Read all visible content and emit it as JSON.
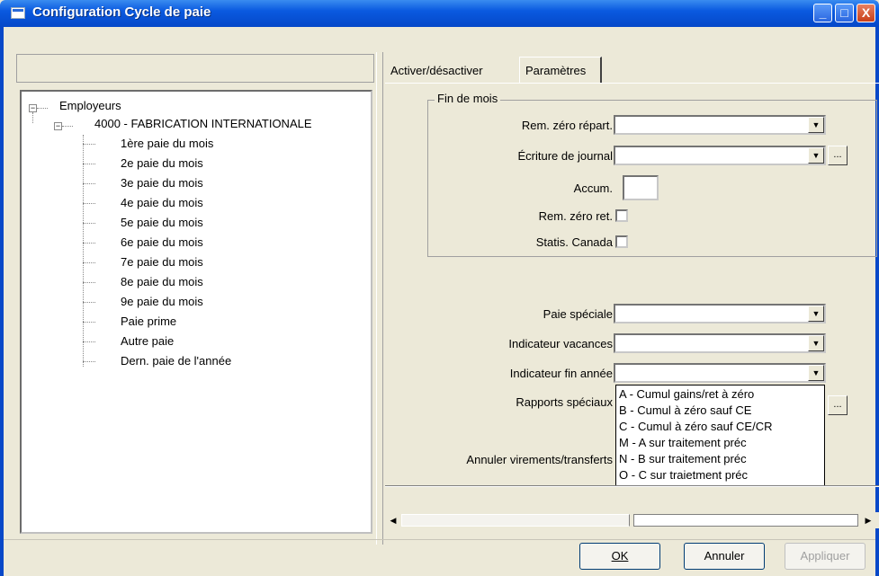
{
  "window": {
    "title": "Configuration Cycle de paie",
    "buttons": {
      "minimize": "_",
      "maximize": "□",
      "close": "X"
    }
  },
  "tree": {
    "root": "Employeurs",
    "company": "4000 - FABRICATION INTERNATIONALE",
    "items": [
      "1ère paie du mois",
      "2e paie du mois",
      "3e paie du mois",
      "4e paie du mois",
      "5e paie du mois",
      "6e paie du mois",
      "7e paie du mois",
      "8e paie du mois",
      "9e paie du mois",
      "Paie prime",
      "Autre paie",
      "Dern. paie de l'année"
    ]
  },
  "tabs": {
    "inactive": "Activer/désactiver",
    "active": "Paramètres"
  },
  "group": {
    "label": "Fin de mois"
  },
  "fields": {
    "rem_zero_repart": "Rem. zéro répart.",
    "ecriture_journal": "Écriture de journal",
    "accum": "Accum.",
    "rem_zero_ret": "Rem. zéro ret.",
    "statis_canada": "Statis. Canada",
    "paie_speciale": "Paie spéciale",
    "indicateur_vacances": "Indicateur vacances",
    "indicateur_fin_annee": "Indicateur fin année",
    "rapports_speciaux": "Rapports spéciaux",
    "annuler_virements": "Annuler virements/transferts",
    "ellipsis": "..."
  },
  "dropdown": {
    "options": [
      "A - Cumul gains/ret à zéro",
      "B - Cumul à zéro sauf CE",
      "C - Cumul à zéro sauf CE/CR",
      "M - A sur traitement préc",
      "N - B sur traitement préc",
      "O - C sur traietment préc"
    ]
  },
  "footer": {
    "ok": "OK",
    "annuler": "Annuler",
    "appliquer": "Appliquer"
  }
}
